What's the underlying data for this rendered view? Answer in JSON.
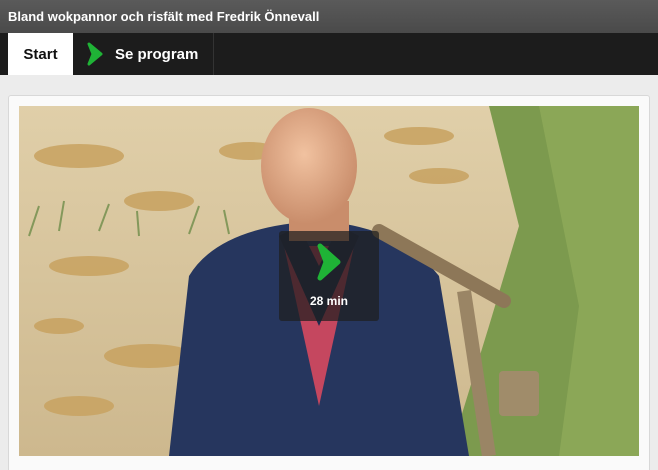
{
  "header": {
    "title": "Bland wokpannor och risfält med Fredrik Önnevall"
  },
  "tabs": [
    {
      "label": "Start",
      "active": true
    },
    {
      "label": "Se program",
      "icon": "svt-play-icon"
    }
  ],
  "video": {
    "duration": "28 min",
    "icon": "svt-play-icon",
    "thumbnail_description": "man carrying a wooden plough in a rice field"
  },
  "colors": {
    "accent_green": "#1fb336",
    "titlebar": "#4f4f4f",
    "tabbar": "#1c1c1c"
  }
}
